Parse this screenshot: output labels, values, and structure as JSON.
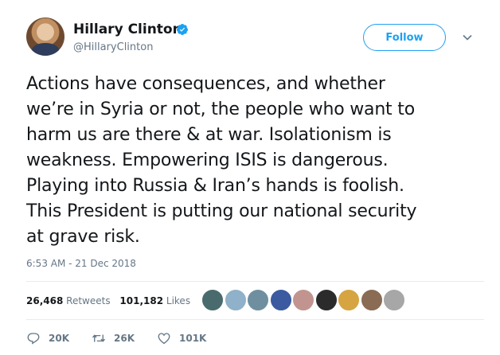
{
  "author": {
    "name": "Hillary Clinton",
    "handle": "@HillaryClinton",
    "verified": true,
    "verified_icon": "verified-badge-icon"
  },
  "header": {
    "follow_label": "Follow",
    "menu_icon": "chevron-down-icon"
  },
  "tweet": {
    "text": "Actions have consequences, and whether\nwe’re in Syria or not, the people who want to\nharm us are there & at war. Isolationism is\nweakness. Empowering ISIS is dangerous.\nPlaying into Russia & Iran’s hands is foolish.\nThis President is putting our national security\nat grave risk.",
    "timestamp": "6:53 AM - 21 Dec 2018"
  },
  "stats": {
    "retweets_count": "26,468",
    "retweets_label": "Retweets",
    "likes_count": "101,182",
    "likes_label": "Likes"
  },
  "liker_avatars": [
    "#4a6b6e",
    "#8fb1c9",
    "#6f8fa0",
    "#3b5aa0",
    "#c2948f",
    "#2b2b2b",
    "#d6a441",
    "#8a6b53",
    "#a7a7a7"
  ],
  "actions": {
    "reply_count": "20K",
    "retweet_count": "26K",
    "like_count": "101K"
  },
  "colors": {
    "accent": "#1da1f2",
    "secondary_text": "#657786",
    "primary_text": "#14171a",
    "divider": "#e6ecf0"
  }
}
